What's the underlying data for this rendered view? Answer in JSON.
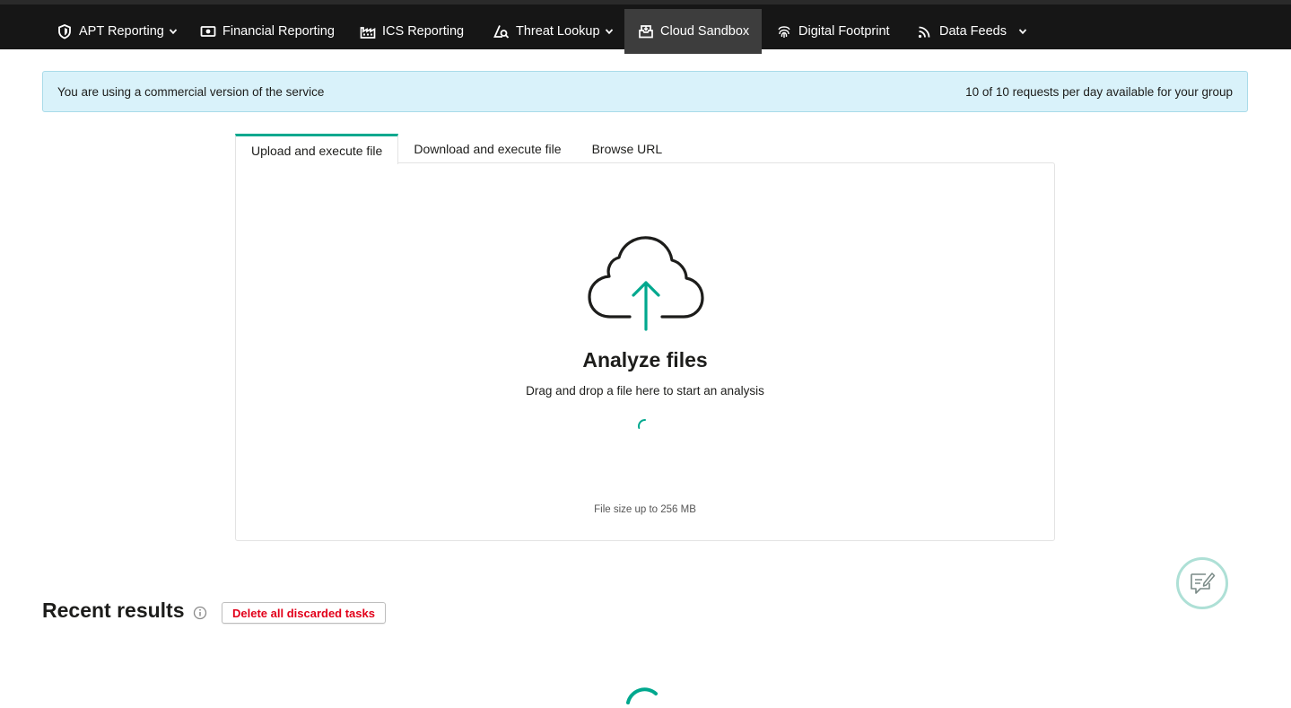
{
  "colors": {
    "nav_bg": "#161616",
    "nav_active_bg": "#3d3d3d",
    "accent": "#00a88e",
    "banner_bg": "#d9f2fa",
    "danger": "#e2001a"
  },
  "nav": {
    "items": [
      {
        "label": "APT Reporting",
        "icon": "shield-icon",
        "dropdown": true
      },
      {
        "label": "Financial Reporting",
        "icon": "banknote-icon",
        "dropdown": false
      },
      {
        "label": "ICS Reporting",
        "icon": "factory-icon",
        "dropdown": false
      },
      {
        "label": "Threat Lookup",
        "icon": "magnifier-triangle-icon",
        "dropdown": true
      },
      {
        "label": "Cloud Sandbox",
        "icon": "sandbox-box-icon",
        "dropdown": false,
        "active": true
      },
      {
        "label": "Digital Footprint",
        "icon": "fingerprint-icon",
        "dropdown": false
      },
      {
        "label": "Data Feeds",
        "icon": "feed-icon",
        "dropdown": true
      }
    ]
  },
  "banner": {
    "left_text": "You are using a commercial version of the service",
    "right_text": "10 of 10 requests per day available for your group"
  },
  "tabs": [
    {
      "label": "Upload and execute file",
      "active": true
    },
    {
      "label": "Download and execute file",
      "active": false
    },
    {
      "label": "Browse URL",
      "active": false
    }
  ],
  "upload": {
    "icon": "cloud-upload-icon",
    "title": "Analyze files",
    "subtitle": "Drag and drop a file here to start an analysis",
    "size_note": "File size up to 256 MB"
  },
  "recent": {
    "title": "Recent results",
    "delete_label": "Delete all discarded tasks"
  },
  "feedback": {
    "icon": "feedback-edit-icon"
  }
}
